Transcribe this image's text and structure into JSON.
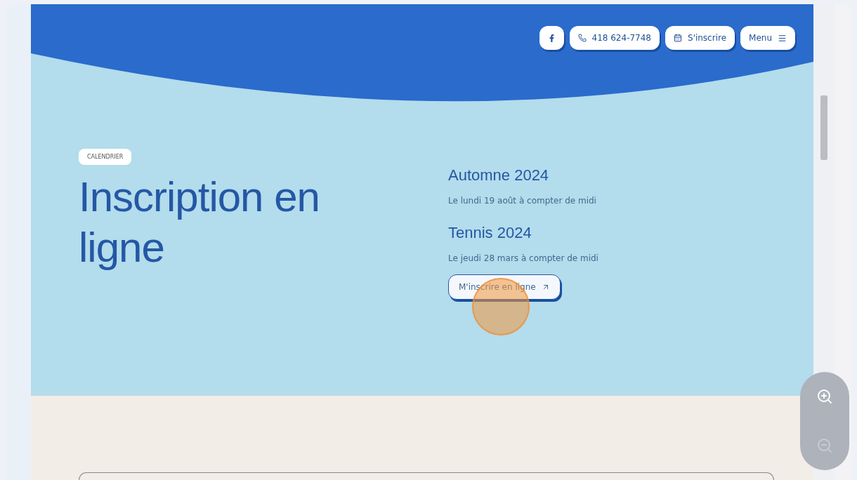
{
  "nav": [
    {
      "kind": "facebook"
    },
    {
      "kind": "phone",
      "label": "418 624-7748"
    },
    {
      "kind": "calendar",
      "label": "S'inscrire"
    },
    {
      "kind": "menu",
      "label": "Menu"
    }
  ],
  "hero": {
    "tag": "CALENDRIER",
    "title": "Inscription en ligne",
    "sessions": [
      {
        "title": "Automne 2024",
        "date": "Le lundi 19 août à compter de midi"
      },
      {
        "title": "Tennis 2024",
        "date": "Le jeudi 28 mars à compter de midi"
      }
    ],
    "cta": "M'inscrire en ligne"
  },
  "zoom": {
    "controls": [
      {
        "kind": "in",
        "disabled": false
      },
      {
        "kind": "out",
        "disabled": true
      }
    ]
  }
}
